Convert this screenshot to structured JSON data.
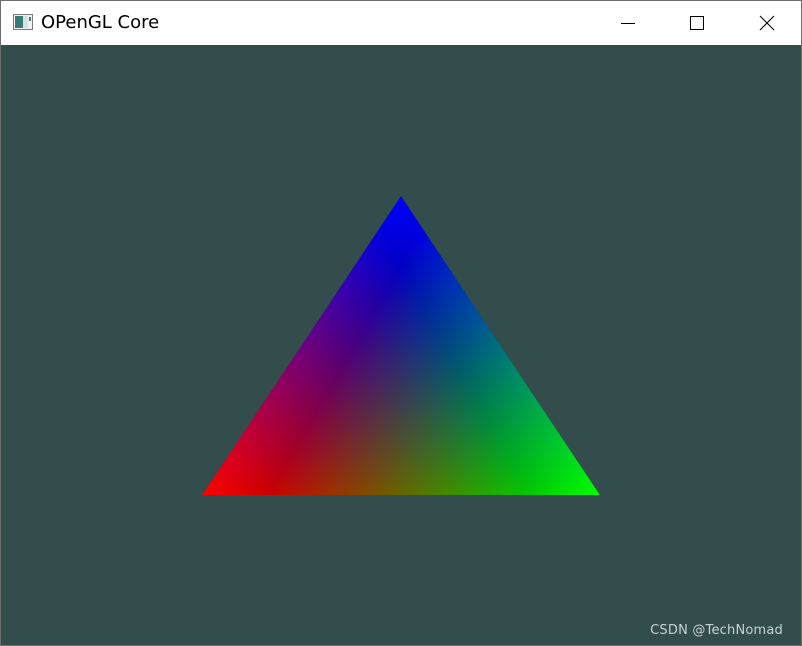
{
  "window": {
    "title": "OPenGL Core",
    "app_icon": "window-app-icon",
    "controls": {
      "minimize_icon": "minimize-icon",
      "maximize_icon": "maximize-icon",
      "close_icon": "close-icon"
    }
  },
  "scene": {
    "clear_color": "#334d4d",
    "triangle": {
      "vertex_colors": {
        "top": "#0000ff",
        "bottom_left": "#ff0000",
        "bottom_right": "#00ff00"
      }
    }
  },
  "watermark": "CSDN @TechNomad"
}
